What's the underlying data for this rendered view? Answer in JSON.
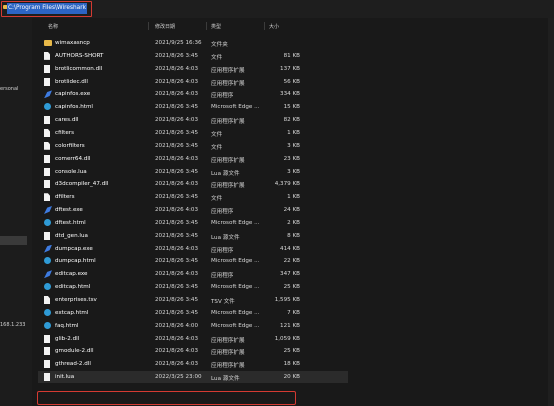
{
  "address_bar": {
    "path": "C:\\Program Files\\Wireshark"
  },
  "nav": {
    "labels": [
      "ersonal",
      "168.1.233"
    ]
  },
  "columns": {
    "name": "名称",
    "date": "修改日期",
    "type": "类型",
    "size": "大小"
  },
  "files": [
    {
      "name": "wimaxasncp",
      "date": "2021/9/25 16:36",
      "type": "文件夹",
      "size": "",
      "icon": "folder-icon"
    },
    {
      "name": "AUTHORS-SHORT",
      "date": "2021/8/26 3:45",
      "type": "文件",
      "size": "81 KB",
      "icon": "file-icon"
    },
    {
      "name": "brotlicommon.dll",
      "date": "2021/8/26 4:03",
      "type": "应用程序扩展",
      "size": "137 KB",
      "icon": "dll-icon"
    },
    {
      "name": "brotlidec.dll",
      "date": "2021/8/26 4:03",
      "type": "应用程序扩展",
      "size": "56 KB",
      "icon": "dll-icon"
    },
    {
      "name": "capinfos.exe",
      "date": "2021/8/26 4:03",
      "type": "应用程序",
      "size": "334 KB",
      "icon": "exe-icon"
    },
    {
      "name": "capinfos.html",
      "date": "2021/8/26 3:45",
      "type": "Microsoft Edge ...",
      "size": "15 KB",
      "icon": "edge-icon"
    },
    {
      "name": "cares.dll",
      "date": "2021/8/26 4:03",
      "type": "应用程序扩展",
      "size": "82 KB",
      "icon": "dll-icon"
    },
    {
      "name": "cfilters",
      "date": "2021/8/26 3:45",
      "type": "文件",
      "size": "1 KB",
      "icon": "file-icon"
    },
    {
      "name": "colorfilters",
      "date": "2021/8/26 3:45",
      "type": "文件",
      "size": "3 KB",
      "icon": "file-icon"
    },
    {
      "name": "comerr64.dll",
      "date": "2021/8/26 4:03",
      "type": "应用程序扩展",
      "size": "23 KB",
      "icon": "dll-icon"
    },
    {
      "name": "console.lua",
      "date": "2021/8/26 3:45",
      "type": "Lua 源文件",
      "size": "3 KB",
      "icon": "lua-icon"
    },
    {
      "name": "d3dcompiler_47.dll",
      "date": "2021/8/26 4:03",
      "type": "应用程序扩展",
      "size": "4,379 KB",
      "icon": "dll-icon"
    },
    {
      "name": "dfilters",
      "date": "2021/8/26 3:45",
      "type": "文件",
      "size": "1 KB",
      "icon": "file-icon"
    },
    {
      "name": "dftest.exe",
      "date": "2021/8/26 4:03",
      "type": "应用程序",
      "size": "24 KB",
      "icon": "exe-icon"
    },
    {
      "name": "dftest.html",
      "date": "2021/8/26 3:45",
      "type": "Microsoft Edge ...",
      "size": "2 KB",
      "icon": "edge-icon"
    },
    {
      "name": "dtd_gen.lua",
      "date": "2021/8/26 3:45",
      "type": "Lua 源文件",
      "size": "8 KB",
      "icon": "lua-icon"
    },
    {
      "name": "dumpcap.exe",
      "date": "2021/8/26 4:03",
      "type": "应用程序",
      "size": "414 KB",
      "icon": "exe-icon"
    },
    {
      "name": "dumpcap.html",
      "date": "2021/8/26 3:45",
      "type": "Microsoft Edge ...",
      "size": "22 KB",
      "icon": "edge-icon"
    },
    {
      "name": "editcap.exe",
      "date": "2021/8/26 4:03",
      "type": "应用程序",
      "size": "347 KB",
      "icon": "exe-icon"
    },
    {
      "name": "editcap.html",
      "date": "2021/8/26 3:45",
      "type": "Microsoft Edge ...",
      "size": "25 KB",
      "icon": "edge-icon"
    },
    {
      "name": "enterprises.tsv",
      "date": "2021/8/26 3:45",
      "type": "TSV 文件",
      "size": "1,595 KB",
      "icon": "file-icon"
    },
    {
      "name": "extcap.html",
      "date": "2021/8/26 3:45",
      "type": "Microsoft Edge ...",
      "size": "7 KB",
      "icon": "edge-icon"
    },
    {
      "name": "faq.html",
      "date": "2021/8/26 4:00",
      "type": "Microsoft Edge ...",
      "size": "121 KB",
      "icon": "edge-icon"
    },
    {
      "name": "glib-2.dll",
      "date": "2021/8/26 4:03",
      "type": "应用程序扩展",
      "size": "1,059 KB",
      "icon": "dll-icon"
    },
    {
      "name": "gmodule-2.dll",
      "date": "2021/8/26 4:03",
      "type": "应用程序扩展",
      "size": "25 KB",
      "icon": "dll-icon"
    },
    {
      "name": "gthread-2.dll",
      "date": "2021/8/26 4:03",
      "type": "应用程序扩展",
      "size": "18 KB",
      "icon": "dll-icon"
    },
    {
      "name": "init.lua",
      "date": "2022/3/25 23:00",
      "type": "Lua 源文件",
      "size": "20 KB",
      "icon": "lua-icon"
    }
  ],
  "colors": {
    "highlight_border": "#d43a32",
    "selection": "#2c64c4",
    "folder": "#e8b949"
  }
}
